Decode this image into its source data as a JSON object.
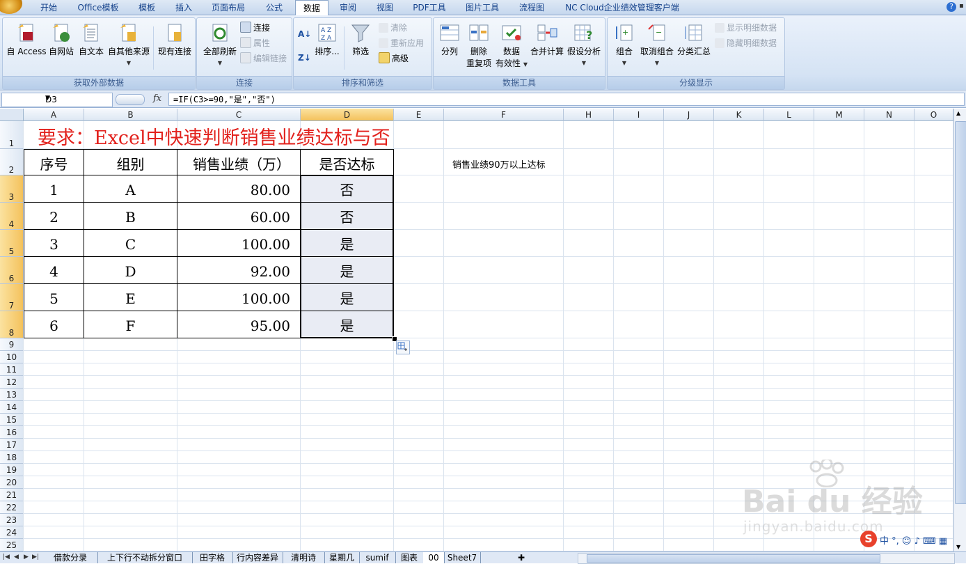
{
  "ribbon_tabs": [
    "开始",
    "Office模板",
    "模板",
    "插入",
    "页面布局",
    "公式",
    "数据",
    "审阅",
    "视图",
    "PDF工具",
    "图片工具",
    "流程图",
    "NC Cloud企业绩效管理客户端"
  ],
  "active_tab": "数据",
  "groups": {
    "external": {
      "label": "获取外部数据",
      "buttons": [
        "自 Access",
        "自网站",
        "自文本",
        "自其他来源",
        "现有连接"
      ]
    },
    "connections": {
      "label": "连接",
      "refresh_all": "全部刷新",
      "connect": "连接",
      "properties": "属性",
      "edit_links": "编辑链接"
    },
    "sort_filter": {
      "label": "排序和筛选",
      "sort": "排序...",
      "filter": "筛选",
      "clear": "清除",
      "reapply": "重新应用",
      "advanced": "高级"
    },
    "data_tools": {
      "label": "数据工具",
      "split": "分列",
      "remove_dup_1": "删除",
      "remove_dup_2": "重复项",
      "validation_1": "数据",
      "validation_2": "有效性",
      "consolidate": "合并计算",
      "whatif": "假设分析"
    },
    "outline": {
      "label": "分级显示",
      "group": "组合",
      "ungroup": "取消组合",
      "subtotal": "分类汇总",
      "show_detail": "显示明细数据",
      "hide_detail": "隐藏明细数据"
    }
  },
  "formula_bar": {
    "name_box": "D3",
    "fx": "fx",
    "formula": "=IF(C3>=90,\"是\",\"否\")"
  },
  "columns": [
    "A",
    "B",
    "C",
    "D",
    "E",
    "F",
    "H",
    "I",
    "J",
    "K",
    "L",
    "M",
    "N",
    "O"
  ],
  "rows": [
    "1",
    "2",
    "3",
    "4",
    "5",
    "6",
    "7",
    "8",
    "9",
    "10",
    "11",
    "12",
    "13",
    "14",
    "15",
    "16",
    "17",
    "18",
    "19",
    "20",
    "21",
    "22",
    "23",
    "24",
    "25"
  ],
  "sheet": {
    "title": "要求：Excel中快速判断销售业绩达标与否",
    "note": "销售业绩90万以上达标",
    "headers": [
      "序号",
      "组别",
      "销售业绩（万）",
      "是否达标"
    ],
    "table": [
      [
        "1",
        "A",
        "80.00",
        "否"
      ],
      [
        "2",
        "B",
        "60.00",
        "否"
      ],
      [
        "3",
        "C",
        "100.00",
        "是"
      ],
      [
        "4",
        "D",
        "92.00",
        "是"
      ],
      [
        "5",
        "E",
        "100.00",
        "是"
      ],
      [
        "6",
        "F",
        "95.00",
        "是"
      ]
    ]
  },
  "sheet_tabs": [
    "借款分录",
    "上下行不动拆分窗口",
    "田字格",
    "行内容差异",
    "清明诗",
    "星期几",
    "sumif",
    "图表",
    "00",
    "Sheet7"
  ],
  "active_sheet": "00",
  "ime": {
    "logo": "S",
    "text": "中 °, ☺ ♪ ⌨ ▦"
  },
  "watermark": {
    "text": "Bai du 经验",
    "sub": "jingyan.baidu.com"
  },
  "colors": {
    "accent": "#15428b",
    "title_red": "#e2211c",
    "selection": "#f4c25c"
  }
}
